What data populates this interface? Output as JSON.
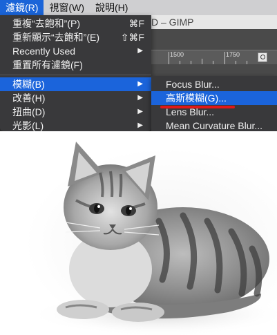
{
  "menubar": {
    "items": [
      {
        "label": "濾鏡(R)",
        "active": true
      },
      {
        "label": "視窗(W)",
        "active": false
      },
      {
        "label": "說明(H)",
        "active": false
      }
    ]
  },
  "gimp": {
    "title_fragment": "D – GIMP",
    "ruler": {
      "label1": "1500",
      "label2": "1750"
    }
  },
  "menu": {
    "items": [
      {
        "label": "重複“去飽和”(P)",
        "shortcut": "⌘F"
      },
      {
        "label": "重新顯示“去飽和”(E)",
        "shortcut": "⇧⌘F"
      },
      {
        "label": "Recently Used",
        "submenu": true
      },
      {
        "label": "重置所有濾鏡(F)"
      },
      {
        "label": "模糊(B)",
        "submenu": true,
        "highlighted": true
      },
      {
        "label": "改善(H)",
        "submenu": true
      },
      {
        "label": "扭曲(D)",
        "submenu": true
      },
      {
        "label": "光影(L)",
        "submenu": true
      }
    ]
  },
  "submenu": {
    "items": [
      {
        "label": "Focus Blur..."
      },
      {
        "label": "高斯模糊(G)...",
        "highlighted": true
      },
      {
        "label": "Lens Blur..."
      },
      {
        "label": "Mean Curvature Blur..."
      }
    ]
  },
  "colors": {
    "accent": "#1b64db",
    "menu_bg": "#39393b",
    "underline": "#e01818"
  },
  "image": {
    "subject": "grayscale kitten"
  }
}
